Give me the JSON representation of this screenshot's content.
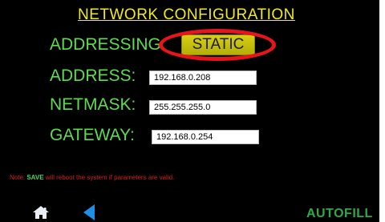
{
  "header": {
    "title": "NETWORK CONFIGURATION"
  },
  "form": {
    "addressing_label": "ADDRESSING:",
    "addressing_mode": "STATIC",
    "address_label": "ADDRESS:",
    "address_value": "192.168.0.208",
    "netmask_label": "NETMASK:",
    "netmask_value": "255.255.255.0",
    "gateway_label": "GATEWAY:",
    "gateway_value": "192.168.0.254"
  },
  "note": {
    "prefix": "Note: ",
    "save_word": "SAVE",
    "suffix": " will reboot the system if parameters are valid."
  },
  "footer": {
    "brand_text": "AUTOFILL",
    "home_icon": "home-icon",
    "back_icon": "back-arrow-icon"
  },
  "colors": {
    "background": "#000000",
    "title": "#f2ea1c",
    "label": "#5edc4e",
    "button": "#d7cf12",
    "highlight_ring": "#e8141c",
    "note": "#d91e1e",
    "back_arrow": "#1e8fe6",
    "brand": "#2fa84a"
  }
}
